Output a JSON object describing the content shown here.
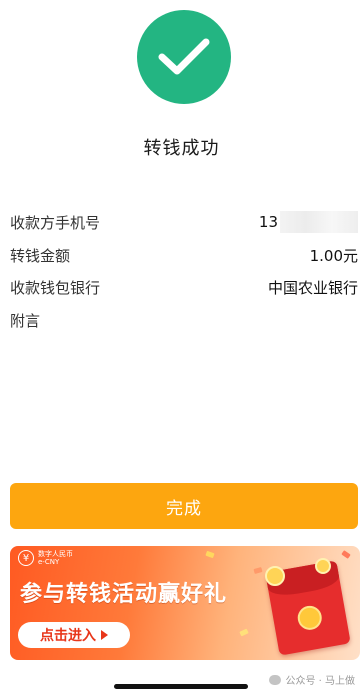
{
  "status": {
    "icon": "check-icon",
    "icon_color": "#23b582",
    "title": "转钱成功"
  },
  "details": [
    {
      "label": "收款方手机号",
      "value": "13"
    },
    {
      "label": "转钱金额",
      "value": "1.00元"
    },
    {
      "label": "收款钱包银行",
      "value": "中国农业银行"
    },
    {
      "label": "附言",
      "value": ""
    }
  ],
  "actions": {
    "done_label": "完成",
    "done_color": "#fda60f"
  },
  "banner": {
    "logo_icon": "yuan-icon",
    "logo_cn": "数字人民币",
    "logo_en": "e-CNY",
    "headline": "参与转钱活动赢好礼",
    "button_label": "点击进入"
  },
  "watermark": {
    "icon": "wechat-channel-icon",
    "text": "公众号 · 马上做"
  }
}
